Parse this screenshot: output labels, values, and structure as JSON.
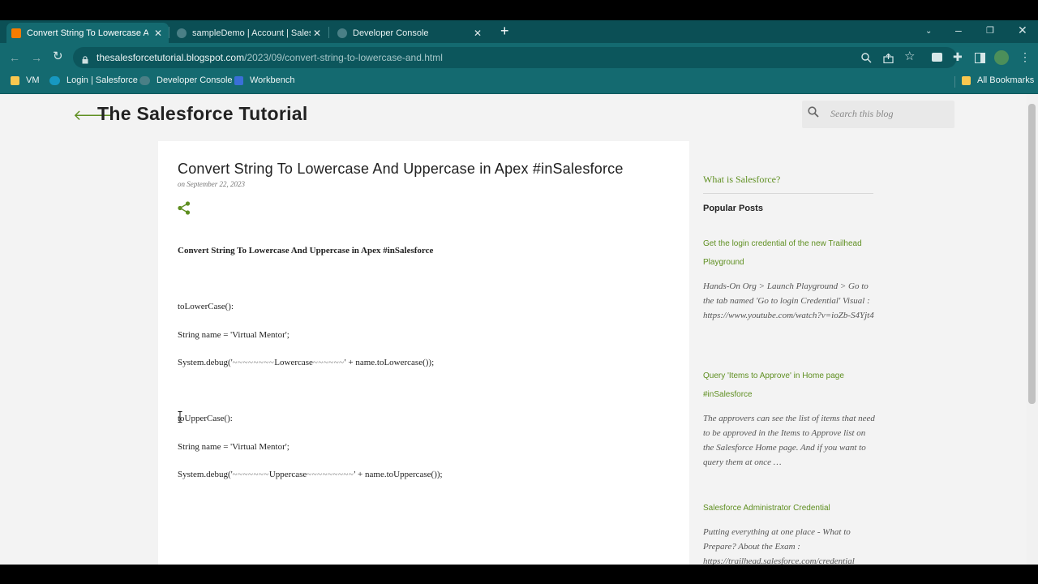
{
  "browser": {
    "tabs": [
      {
        "title": "Convert String To Lowercase And",
        "favicon_color": "#f57c00",
        "active": true
      },
      {
        "title": "sampleDemo | Account | Salesfor",
        "favicon_color": "#4a7f86",
        "active": false
      },
      {
        "title": "Developer Console",
        "favicon_color": "#4a7f86",
        "active": false
      }
    ],
    "url_host": "thesalesforcetutorial.blogspot.com",
    "url_path": "/2023/09/convert-string-to-lowercase-and.html",
    "bookmarks": [
      {
        "label": "VM",
        "icon": "folder-icon",
        "color": "#f9c74f"
      },
      {
        "label": "Login | Salesforce",
        "icon": "salesforce-cloud-icon",
        "color": "#1798c1"
      },
      {
        "label": "Developer Console",
        "icon": "cloud-icon",
        "color": "#4a7f86"
      },
      {
        "label": "Workbench",
        "icon": "cube-icon",
        "color": "#3a6fd8"
      }
    ],
    "all_bookmarks": "All Bookmarks"
  },
  "blog": {
    "title": "The Salesforce Tutorial",
    "search_placeholder": "Search this blog",
    "accent_color": "#5f8f21"
  },
  "post": {
    "title": "Convert String To Lowercase And Uppercase in Apex #inSalesforce",
    "date": "on September 22, 2023",
    "heading": "Convert String To Lowercase And Uppercase in Apex #inSalesforce",
    "lines": {
      "lower_method": "toLowerCase():",
      "lower_decl": "String name = 'Virtual Mentor';",
      "lower_debug_a": "System.debug('",
      "lower_debug_t1": "~~~~~~~~",
      "lower_debug_b": "Lowercase",
      "lower_debug_t2": "~~~~~~",
      "lower_debug_c": "' + name.toLowercase());",
      "upper_method": "toUpperCase():",
      "upper_decl": "String name = 'Virtual Mentor';",
      "upper_debug_a": "System.debug('",
      "upper_debug_t1": "~~~~~~~",
      "upper_debug_b": "Uppercase",
      "upper_debug_t2": "~~~~~~~~~",
      "upper_debug_c": "' + name.toUppercase());"
    }
  },
  "sidebar": {
    "what_is": "What is Salesforce?",
    "popular_heading": "Popular Posts",
    "posts": [
      {
        "title": "Get the login credential of the new Trailhead Playground",
        "snippet": " Hands-On Org > Launch Playground > Go to the tab named 'Go to login Credential' Visual :  https://www.youtube.com/watch?v=ioZb-S4Yjt4"
      },
      {
        "title": "Query 'Items to Approve' in Home page #inSalesforce",
        "snippet": "The approvers can see the list of items that need to be approved in the Items to Approve list on the Salesforce Home page. And if you want to query them at once …"
      },
      {
        "title": "Salesforce Administrator Credential",
        "snippet": "Putting everything at one place - What to Prepare? About the Exam : https://trailhead.salesforce.com/credential"
      }
    ]
  }
}
